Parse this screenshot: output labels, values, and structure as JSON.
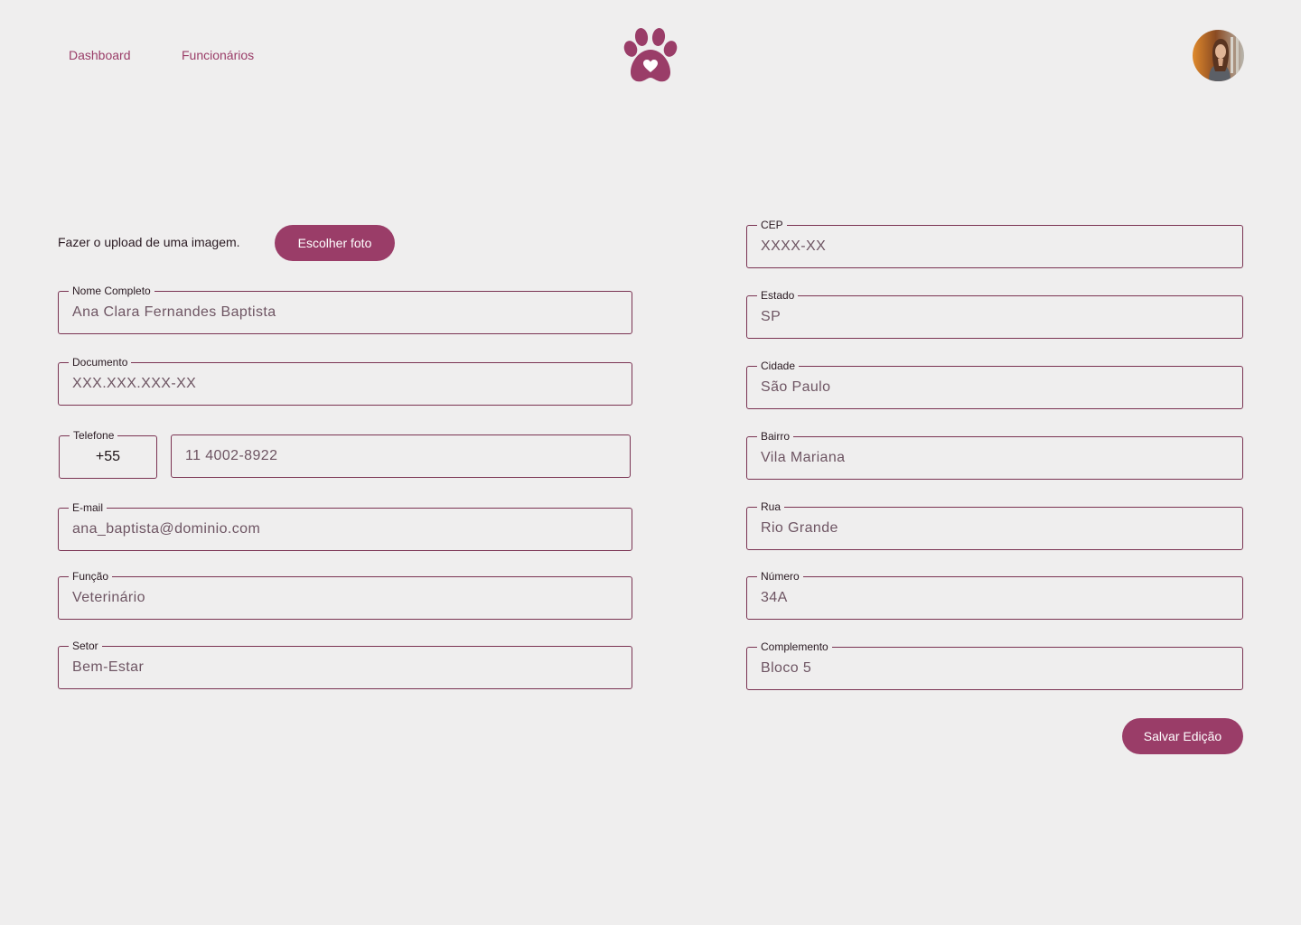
{
  "nav": {
    "dashboard": "Dashboard",
    "employees": "Funcionários"
  },
  "brand": {
    "icon": "paw-heart-icon",
    "color": "#9a3d68"
  },
  "user": {
    "avatar_icon": "user-avatar"
  },
  "upload": {
    "text": "Fazer o upload de uma imagem.",
    "button": "Escolher foto"
  },
  "personal": {
    "full_name": {
      "label": "Nome Completo",
      "value": "Ana Clara Fernandes Baptista"
    },
    "document": {
      "label": "Documento",
      "value": "XXX.XXX.XXX-XX"
    },
    "phone": {
      "label": "Telefone",
      "country_code": "+55",
      "value": "11 4002-8922"
    },
    "email": {
      "label": "E-mail",
      "value": "ana_baptista@dominio.com"
    },
    "role": {
      "label": "Função",
      "value": "Veterinário"
    },
    "sector": {
      "label": "Setor",
      "value": "Bem-Estar"
    }
  },
  "address": {
    "cep": {
      "label": "CEP",
      "value": "XXXX-XX"
    },
    "state": {
      "label": "Estado",
      "value": "SP"
    },
    "city": {
      "label": "Cidade",
      "value": "São Paulo"
    },
    "neighborhood": {
      "label": "Bairro",
      "value": "Vila Mariana"
    },
    "street": {
      "label": "Rua",
      "value": "Rio Grande"
    },
    "number": {
      "label": "Número",
      "value": "34A"
    },
    "complement": {
      "label": "Complemento",
      "value": "Bloco 5"
    }
  },
  "actions": {
    "save": "Salvar Edição"
  }
}
